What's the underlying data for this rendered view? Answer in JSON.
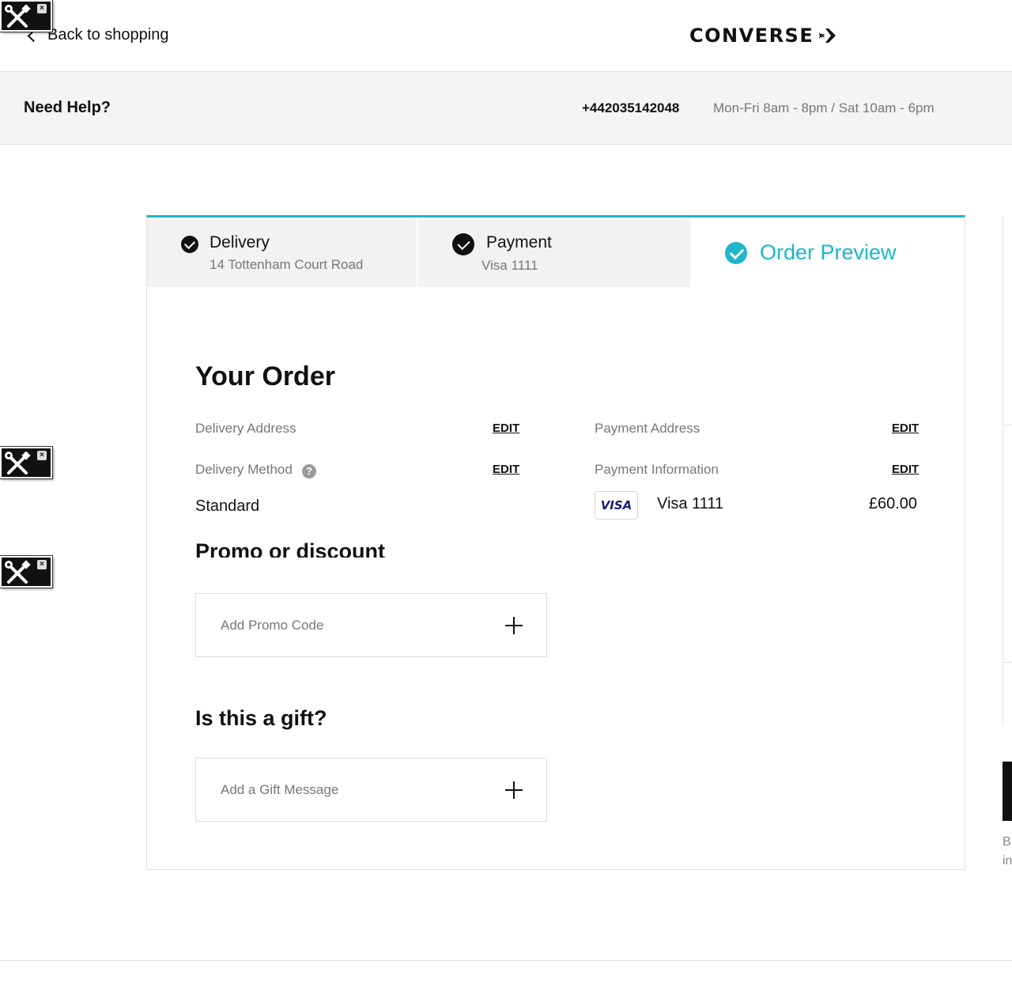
{
  "header": {
    "back_label": "Back to shopping",
    "logo_text": "CONVERSE"
  },
  "help": {
    "title": "Need Help?",
    "phone": "+442035142048",
    "hours": "Mon-Fri 8am - 8pm / Sat 10am - 6pm"
  },
  "steps": [
    {
      "title": "Delivery",
      "subtitle": "14 Tottenham Court Road",
      "state": "complete"
    },
    {
      "title": "Payment",
      "subtitle": "Visa 1111",
      "state": "complete"
    },
    {
      "title": "Order Preview",
      "state": "active"
    }
  ],
  "order": {
    "title": "Your Order",
    "delivery_address_label": "Delivery Address",
    "delivery_method_label": "Delivery Method",
    "delivery_method_value": "Standard",
    "payment_address_label": "Payment Address",
    "payment_information_label": "Payment Information",
    "edit_label": "EDIT",
    "help_glyph": "?",
    "card_brand": "VISA",
    "card_label": "Visa 1111",
    "amount": "£60.00"
  },
  "promo": {
    "title": "Promo or discount",
    "add_label": "Add Promo Code"
  },
  "gift": {
    "title": "Is this a gift?",
    "add_label": "Add a Gift Message"
  },
  "sidebar_partial": {
    "line1": "B",
    "line2": "in"
  },
  "colors": {
    "accent": "#1cb7c8",
    "text": "#111111",
    "muted": "#777777",
    "help_bg": "#f4f4f4"
  },
  "icons": [
    "chevron-left-icon",
    "converse-star-chevron-icon",
    "check-circle-icon",
    "question-icon",
    "visa-logo-icon",
    "plus-icon",
    "tools-icon",
    "close-icon"
  ]
}
